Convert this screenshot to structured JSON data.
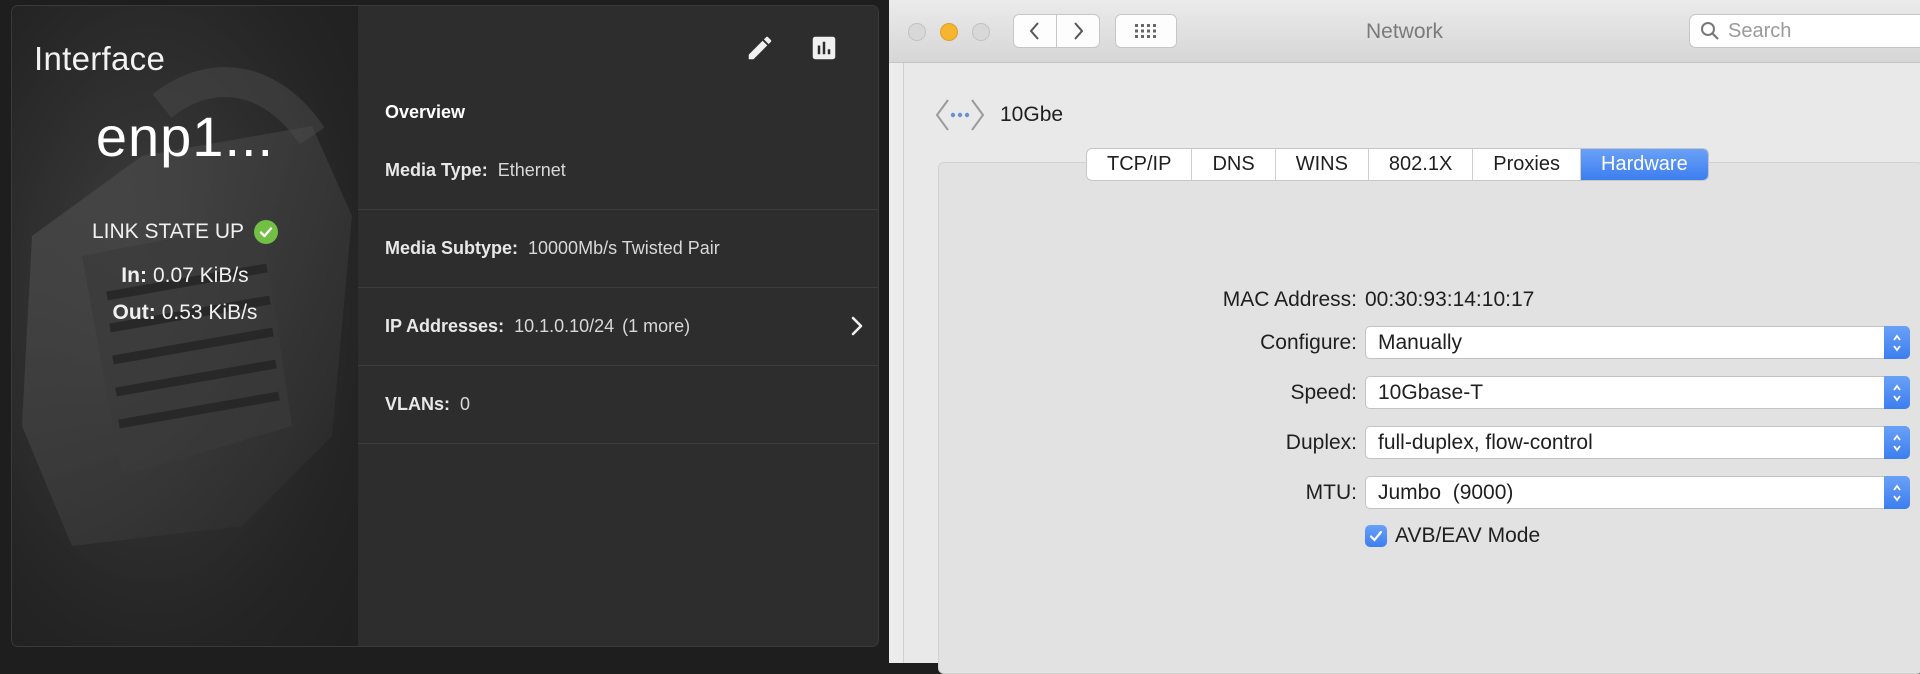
{
  "left": {
    "title": "Interface",
    "name": "enp1...",
    "link_state": "LINK STATE UP",
    "in_label": "In:",
    "in_value": "0.07 KiB/s",
    "out_label": "Out:",
    "out_value": "0.53 KiB/s",
    "section_title": "Overview",
    "rows": [
      {
        "label": "Media Type:",
        "value": "Ethernet",
        "more": ""
      },
      {
        "label": "Media Subtype:",
        "value": "10000Mb/s Twisted Pair",
        "more": ""
      },
      {
        "label": "IP Addresses:",
        "value": "10.1.0.10/24",
        "more": "(1 more)"
      },
      {
        "label": "VLANs:",
        "value": "0",
        "more": ""
      }
    ],
    "icons": {
      "edit": "pencil-icon",
      "stats": "bar-chart-icon",
      "status": "check-circle-icon"
    },
    "colors": {
      "ok": "#71bf44"
    }
  },
  "mac": {
    "window_title": "Network",
    "search_placeholder": "Search",
    "interface_name": "10Gbe",
    "tabs": [
      "TCP/IP",
      "DNS",
      "WINS",
      "802.1X",
      "Proxies",
      "Hardware"
    ],
    "active_tab": "Hardware",
    "mac_label": "MAC Address:",
    "mac_value": "00:30:93:14:10:17",
    "configure_label": "Configure:",
    "configure_value": "Manually",
    "speed_label": "Speed:",
    "speed_value": "10Gbase-T",
    "duplex_label": "Duplex:",
    "duplex_value": "full-duplex, flow-control",
    "mtu_label": "MTU:",
    "mtu_value": "Jumbo  (9000)",
    "avb_label": "AVB/EAV Mode",
    "avb_checked": true,
    "colors": {
      "accent": "#3c7ef0",
      "close": "#d8d8d8",
      "minimize": "#f5b52e",
      "zoom": "#d8d8d8"
    }
  }
}
